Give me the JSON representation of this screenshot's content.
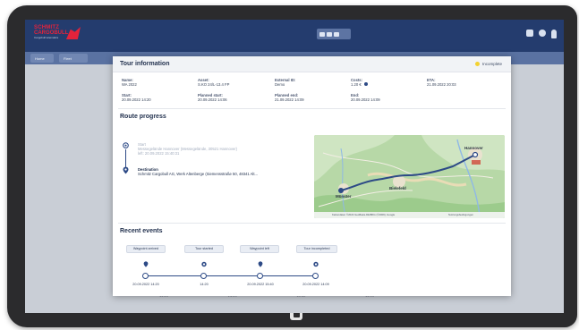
{
  "app": {
    "logo_line1": "SCHMITZ",
    "logo_line2": "CARGOBULL",
    "logo_line3": "Cargobull telematics"
  },
  "subbar": {
    "tabs": [
      {
        "label": "Home"
      },
      {
        "label": "Fleet"
      }
    ]
  },
  "background": {
    "times": [
      "14:20",
      "14:20",
      "15:40",
      "14:09"
    ]
  },
  "modal": {
    "title": "Tour information",
    "status": {
      "label": "Incomplete",
      "color": "#f3d231"
    },
    "fields": [
      {
        "label": "Name:",
        "value": "WA 2022"
      },
      {
        "label": "Asset:",
        "value": "S.KO 24/L-13.4 FP"
      },
      {
        "label": "External ID:",
        "value": "Demo"
      },
      {
        "label": "Costs:",
        "value": "1.20 €"
      },
      {
        "label": "ETA:",
        "value": "21.09.2022 20:03"
      },
      {
        "label": "Start:",
        "value": "20.09.2022 14:20"
      },
      {
        "label": "Planned start:",
        "value": "20.09.2022 14:06"
      },
      {
        "label": "Planned end:",
        "value": "21.09.2022 14:09"
      },
      {
        "label": "End:",
        "value": "20.09.2022 14:09"
      }
    ]
  },
  "route": {
    "title": "Route progress",
    "start": {
      "label": "Start",
      "address": "Messegelände Hannover (Messegelände, 30521 Hannover)",
      "time": "left: 20.09.2022 15:40:31"
    },
    "destination": {
      "label": "Destination",
      "address": "Schmitz Cargobull AG, Werk Altenberge (Siemensstraße 50, 48341 Alt..."
    },
    "map": {
      "cities": [
        "Hannover",
        "Bielefeld",
        "Münster"
      ],
      "attribution": "Kartendaten ©2022 GeoBasis-DE/BKG (©2009), Google",
      "terms": "Nutzungsbedingungen"
    }
  },
  "events": {
    "title": "Recent events",
    "items": [
      {
        "label": "Waypoint arrived",
        "time": "20.09.2022 14:20"
      },
      {
        "label": "Tour started",
        "time": "14:20"
      },
      {
        "label": "Waypoint left",
        "time": "20.09.2022 15:40"
      },
      {
        "label": "Tour incompleted",
        "time": "20.09.2022 14:09"
      }
    ]
  },
  "colors": {
    "appbar": "#243c6e",
    "accent": "#2d4a86",
    "brand_red": "#e2233b",
    "status_yellow": "#f3d231"
  }
}
